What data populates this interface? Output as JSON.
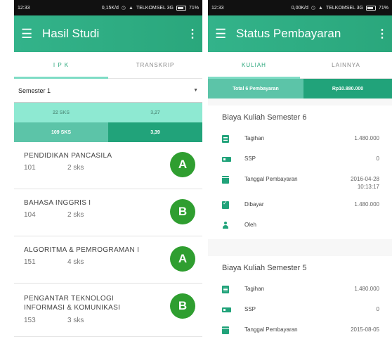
{
  "left": {
    "status": {
      "time": "12:33",
      "speed": "0,15K/d",
      "carrier": "TELKOMSEL 3G",
      "battery": "71%"
    },
    "appbar": {
      "title": "Hasil Studi",
      "menu_icon": "hamburger-icon",
      "more_icon": "more-vert-icon"
    },
    "tabs": [
      {
        "label": "I P K"
      },
      {
        "label": "TRANSKRIP"
      }
    ],
    "semester": {
      "selected": "Semester 1"
    },
    "summary": [
      {
        "sks": "22 SKS",
        "ip": "3,27"
      },
      {
        "sks": "109 SKS",
        "ip": "3,39"
      }
    ],
    "courses": [
      {
        "name": "PENDIDIKAN PANCASILA",
        "code": "101",
        "sks": "2 sks",
        "grade": "A"
      },
      {
        "name": "BAHASA INGGRIS I",
        "code": "104",
        "sks": "2 sks",
        "grade": "B"
      },
      {
        "name": "ALGORITMA & PEMROGRAMAN I",
        "code": "151",
        "sks": "4 sks",
        "grade": "A"
      },
      {
        "name": "PENGANTAR TEKNOLOGI INFORMASI & KOMUNIKASI",
        "code": "153",
        "sks": "3 sks",
        "grade": "B"
      }
    ]
  },
  "right": {
    "status": {
      "time": "12:33",
      "speed": "0,00K/d",
      "carrier": "TELKOMSEL 3G",
      "battery": "71%"
    },
    "appbar": {
      "title": "Status Pembayaran",
      "menu_icon": "hamburger-icon",
      "more_icon": "more-vert-icon"
    },
    "tabs": [
      {
        "label": "KULIAH"
      },
      {
        "label": "LAINNYA"
      }
    ],
    "total": {
      "label": "Total 6 Pembayaran",
      "amount": "Rp10.880.000"
    },
    "cards": [
      {
        "title": "Biaya Kuliah Semester 6",
        "rows": [
          {
            "icon": "document-icon",
            "label": "Tagihan",
            "value": "1.480.000"
          },
          {
            "icon": "card-icon",
            "label": "SSP",
            "value": "0"
          },
          {
            "icon": "calendar-icon",
            "label": "Tanggal Pembayaran",
            "value": "2016-04-28",
            "value2": "10:13:17"
          },
          {
            "icon": "check-icon",
            "label": "Dibayar",
            "value": "1.480.000"
          },
          {
            "icon": "person-icon",
            "label": "Oleh",
            "value": ""
          }
        ]
      },
      {
        "title": "Biaya Kuliah Semester 5",
        "rows": [
          {
            "icon": "document-icon",
            "label": "Tagihan",
            "value": "1.480.000"
          },
          {
            "icon": "card-icon",
            "label": "SSP",
            "value": "0"
          },
          {
            "icon": "calendar-icon",
            "label": "Tanggal Pembayaran",
            "value": "2015-08-05"
          }
        ]
      }
    ]
  },
  "colors": {
    "primary": "#2aa77c",
    "grade_badge": "#2f9e30",
    "light_accent": "#8ee9d2"
  }
}
